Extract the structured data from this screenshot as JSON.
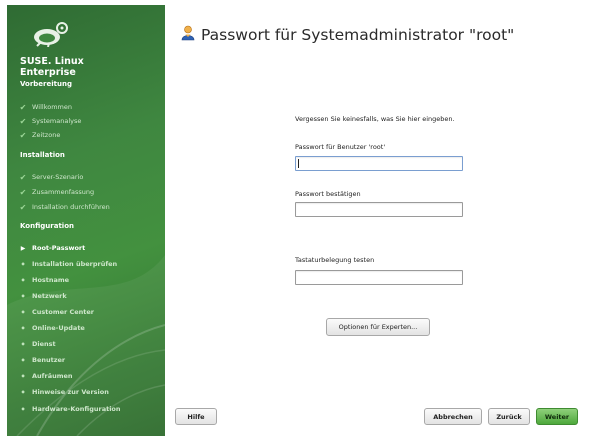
{
  "sidebar": {
    "brand_line1": "SUSE. Linux",
    "brand_line2": "Enterprise",
    "sections": {
      "preparation": "Vorbereitung",
      "installation": "Installation",
      "configuration": "Konfiguration"
    },
    "preparation_steps": [
      {
        "label": "Willkommen",
        "state": "done"
      },
      {
        "label": "Systemanalyse",
        "state": "done"
      },
      {
        "label": "Zeitzone",
        "state": "done"
      }
    ],
    "installation_steps": [
      {
        "label": "Server-Szenario",
        "state": "done"
      },
      {
        "label": "Zusammenfassung",
        "state": "done"
      },
      {
        "label": "Installation durchführen",
        "state": "done"
      }
    ],
    "configuration_steps": [
      {
        "label": "Root-Passwort",
        "state": "current"
      },
      {
        "label": "Installation überprüfen",
        "state": "todo"
      },
      {
        "label": "Hostname",
        "state": "todo"
      },
      {
        "label": "Netzwerk",
        "state": "todo"
      },
      {
        "label": "Customer Center",
        "state": "todo"
      },
      {
        "label": "Online-Update",
        "state": "todo"
      },
      {
        "label": "Dienst",
        "state": "todo"
      },
      {
        "label": "Benutzer",
        "state": "todo"
      },
      {
        "label": "Aufräumen",
        "state": "todo"
      },
      {
        "label": "Hinweise zur Version",
        "state": "todo"
      },
      {
        "label": "Hardware-Konfiguration",
        "state": "todo"
      }
    ]
  },
  "main": {
    "title": "Passwort für Systemadministrator \"root\"",
    "info_text": "Vergessen Sie keinesfalls, was Sie hier eingeben.",
    "password_label": "Passwort für Benutzer 'root'",
    "password_value": "",
    "confirm_label": "Passwort bestätigen",
    "confirm_value": "",
    "keyboard_test_label": "Tastaturbelegung testen",
    "keyboard_test_value": "",
    "expert_options_button": "Optionen für Experten..."
  },
  "footer": {
    "help_button": "Hilfe",
    "cancel_button": "Abbrechen",
    "back_button": "Zurück",
    "next_button": "Weiter"
  },
  "colors": {
    "sidebar_green": "#3f8740",
    "next_button_green": "#4ea83c"
  }
}
